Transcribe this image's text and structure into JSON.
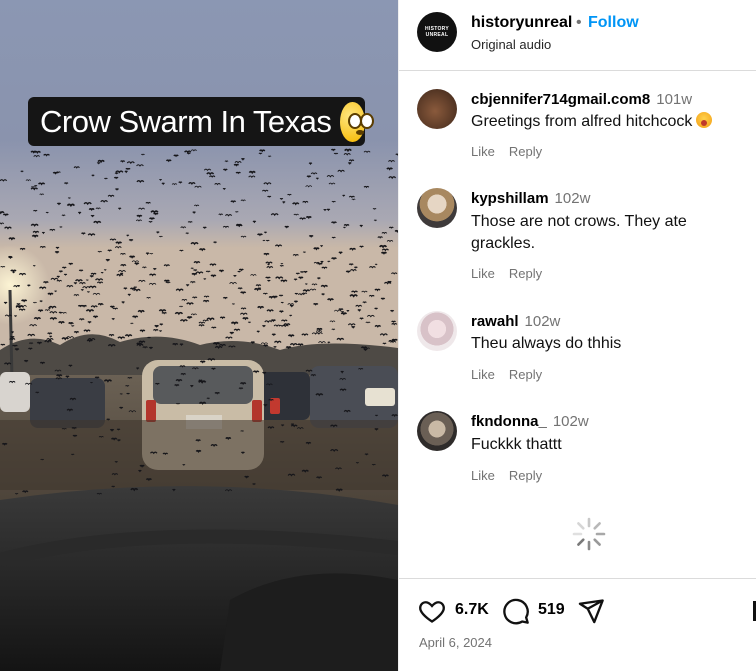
{
  "video": {
    "caption": "Crow Swarm In Texas",
    "caption_emoji": "flushed-face-emoji"
  },
  "post": {
    "username": "historyunreal",
    "avatar_text": "HISTORY UNREAL",
    "separator": "•",
    "follow_label": "Follow",
    "audio_label": "Original audio"
  },
  "comments": [
    {
      "username": "cbjennifer714gmail.com8",
      "time": "101w",
      "text": "Greetings from alfred hitchcock",
      "emoji": "screaming-face-emoji",
      "like_label": "Like",
      "reply_label": "Reply"
    },
    {
      "username": "kypshillam",
      "time": "102w",
      "text": "Those are not crows. They ate grackles.",
      "like_label": "Like",
      "reply_label": "Reply"
    },
    {
      "username": "rawahl",
      "time": "102w",
      "text": "Theu always do thhis",
      "like_label": "Like",
      "reply_label": "Reply"
    },
    {
      "username": "fkndonna_",
      "time": "102w",
      "text": "Fuckkk thattt",
      "like_label": "Like",
      "reply_label": "Reply"
    }
  ],
  "footer": {
    "likes": "6.7K",
    "comments": "519",
    "date": "April 6, 2024"
  },
  "colors": {
    "accent": "#0095f6",
    "muted": "#737373",
    "caption_bg": "#151515"
  }
}
